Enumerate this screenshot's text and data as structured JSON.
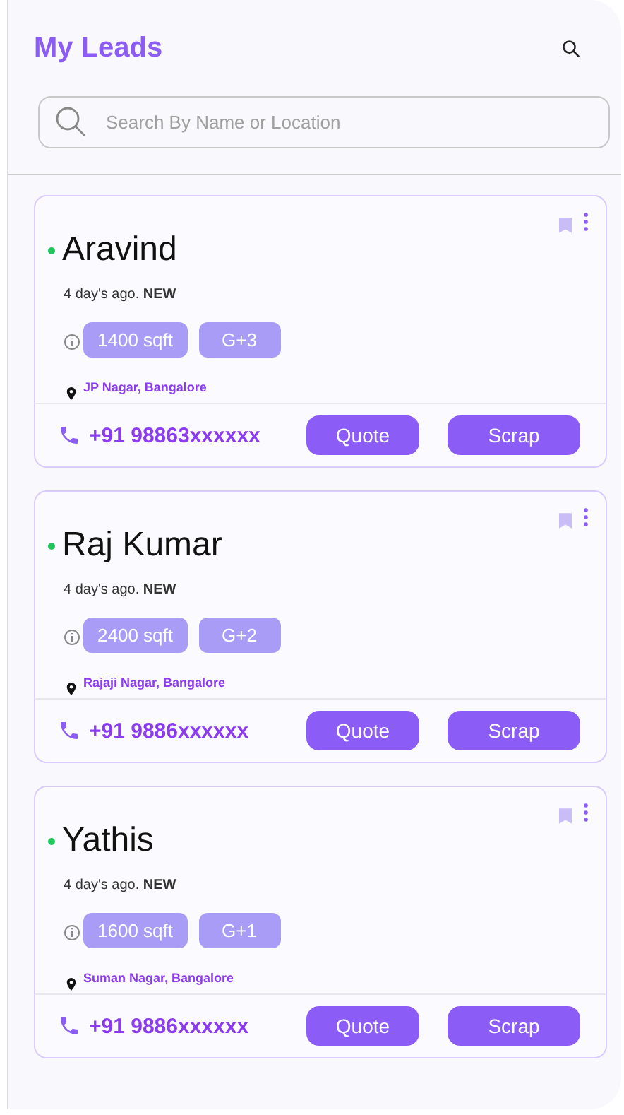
{
  "header": {
    "title": "My Leads"
  },
  "search": {
    "placeholder": "Search By Name or Location"
  },
  "leads": [
    {
      "name": "Aravind",
      "color": "#22c55e",
      "age": "4 day's ago. **NEW**",
      "tags": [
        "1400 sqft",
        "G+3"
      ],
      "location": "JP Nagar, Bangalore",
      "phone": "+91 98863xxxxxx",
      "buttons": [
        "Quote",
        "Scrap"
      ]
    },
    {
      "name": "Raj Kumar",
      "color": "#22c55e",
      "age": "4 day's ago. **NEW**",
      "tags": [
        "2400 sqft",
        "G+2"
      ],
      "location": "Rajaji Nagar, Bangalore",
      "phone": "+91 9886xxxxxx",
      "buttons": [
        "Quote",
        "Scrap"
      ]
    },
    {
      "name": "Yathis",
      "color": "#22c55e",
      "age": "4 day's ago. **NEW**",
      "tags": [
        "1600 sqft",
        "G+1"
      ],
      "location": "Suman Nagar, Bangalore",
      "phone": "+91 9886xxxxxx",
      "buttons": [
        "Quote",
        "Scrap"
      ]
    }
  ]
}
